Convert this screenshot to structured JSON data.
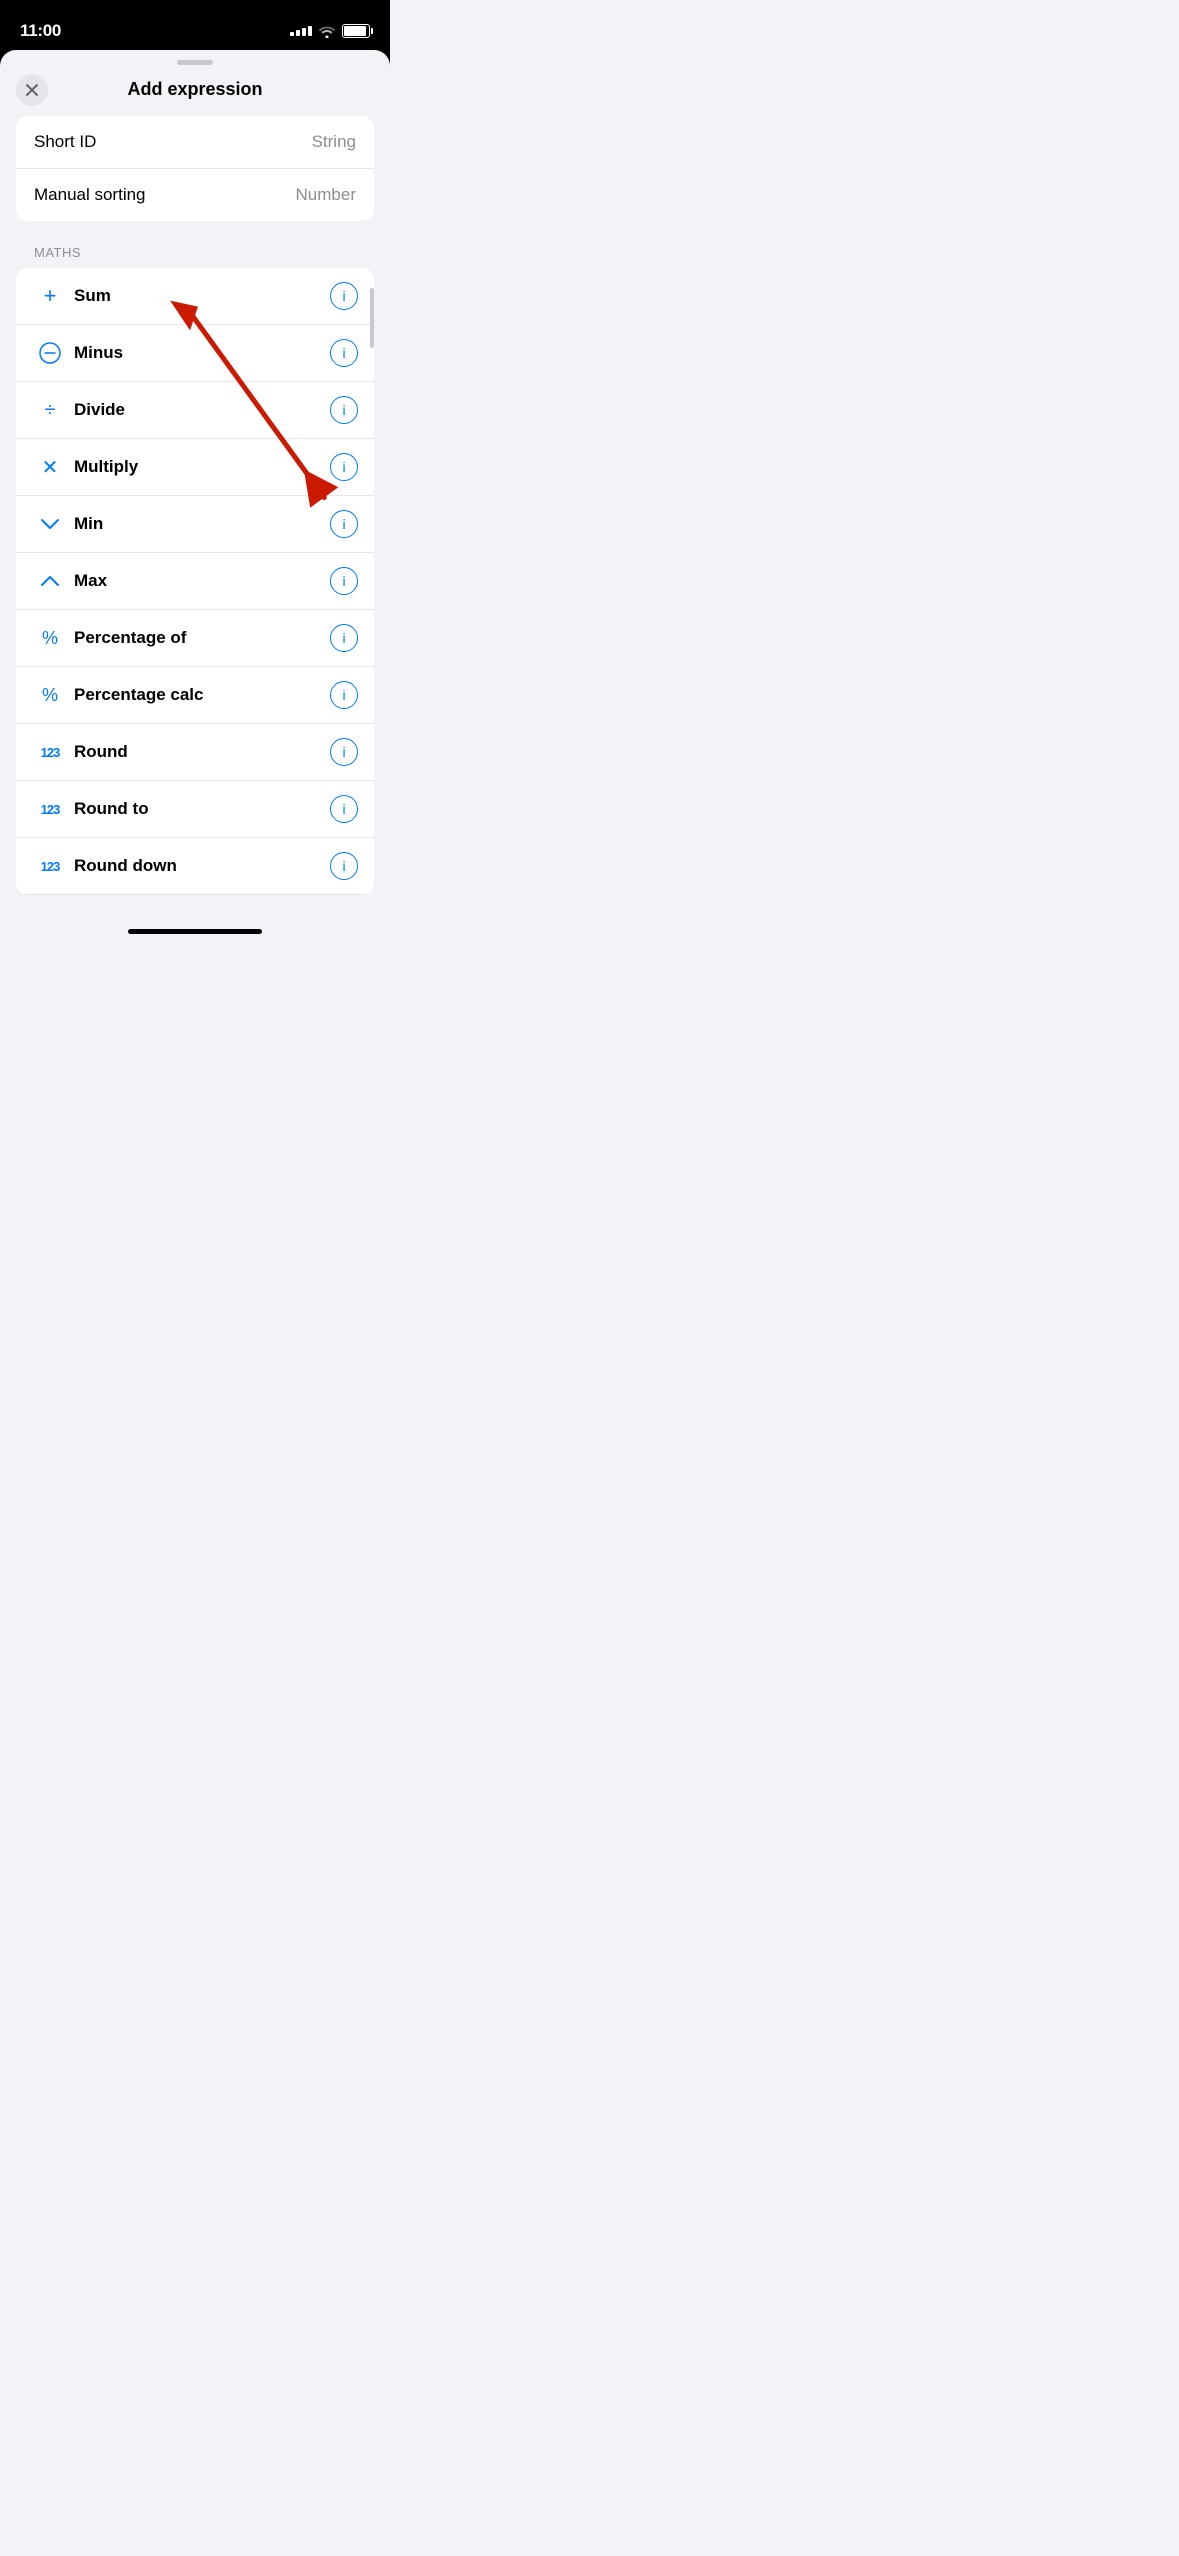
{
  "statusBar": {
    "time": "11:00"
  },
  "modal": {
    "title": "Add expression",
    "close_label": "×"
  },
  "topItems": [
    {
      "label": "Short ID",
      "value": "String"
    },
    {
      "label": "Manual sorting",
      "value": "Number"
    }
  ],
  "section": {
    "header": "MATHS"
  },
  "mathItems": [
    {
      "icon": "+",
      "label": "Sum",
      "id": "sum"
    },
    {
      "icon": "−",
      "label": "Minus",
      "id": "minus"
    },
    {
      "icon": "÷",
      "label": "Divide",
      "id": "divide"
    },
    {
      "icon": "×",
      "label": "Multiply",
      "id": "multiply"
    },
    {
      "icon": "∨",
      "label": "Min",
      "id": "min"
    },
    {
      "icon": "∧",
      "label": "Max",
      "id": "max"
    },
    {
      "icon": "%",
      "label": "Percentage of",
      "id": "percentage-of"
    },
    {
      "icon": "%",
      "label": "Percentage calc",
      "id": "percentage-calc"
    },
    {
      "icon": "123",
      "label": "Round",
      "id": "round"
    },
    {
      "icon": "123",
      "label": "Round to",
      "id": "round-to"
    },
    {
      "icon": "123",
      "label": "Round down",
      "id": "round-down"
    }
  ],
  "info_button_label": "i"
}
